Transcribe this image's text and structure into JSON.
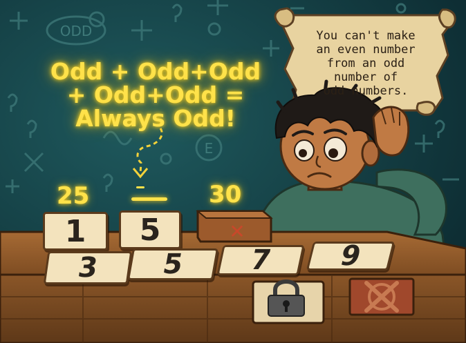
{
  "equation": {
    "line1": "Odd + Odd+Odd",
    "line2": "+ Odd+Odd =",
    "line3": "Always Odd!"
  },
  "scroll": {
    "message": "You can't make\nan even number\nfrom an odd\nnumber of\nodd numbers."
  },
  "target": {
    "left_value": "25",
    "right_value": "30"
  },
  "slots": [
    {
      "value": "1"
    },
    {
      "value": "5"
    },
    {
      "state": "blocked"
    }
  ],
  "hand_cards": [
    {
      "value": "3"
    },
    {
      "value": "5"
    },
    {
      "value": "7"
    },
    {
      "value": "9"
    }
  ],
  "chalk": {
    "odd_badge": "ODD",
    "e_badge": "E"
  },
  "colors": {
    "background": "#123a40",
    "glow_text": "#ffe24a",
    "card": "#f3e3bd",
    "wood": "#7a4a22",
    "x_mark": "#b73a22"
  },
  "icons": [
    "lock-icon",
    "cancel-x-icon"
  ]
}
